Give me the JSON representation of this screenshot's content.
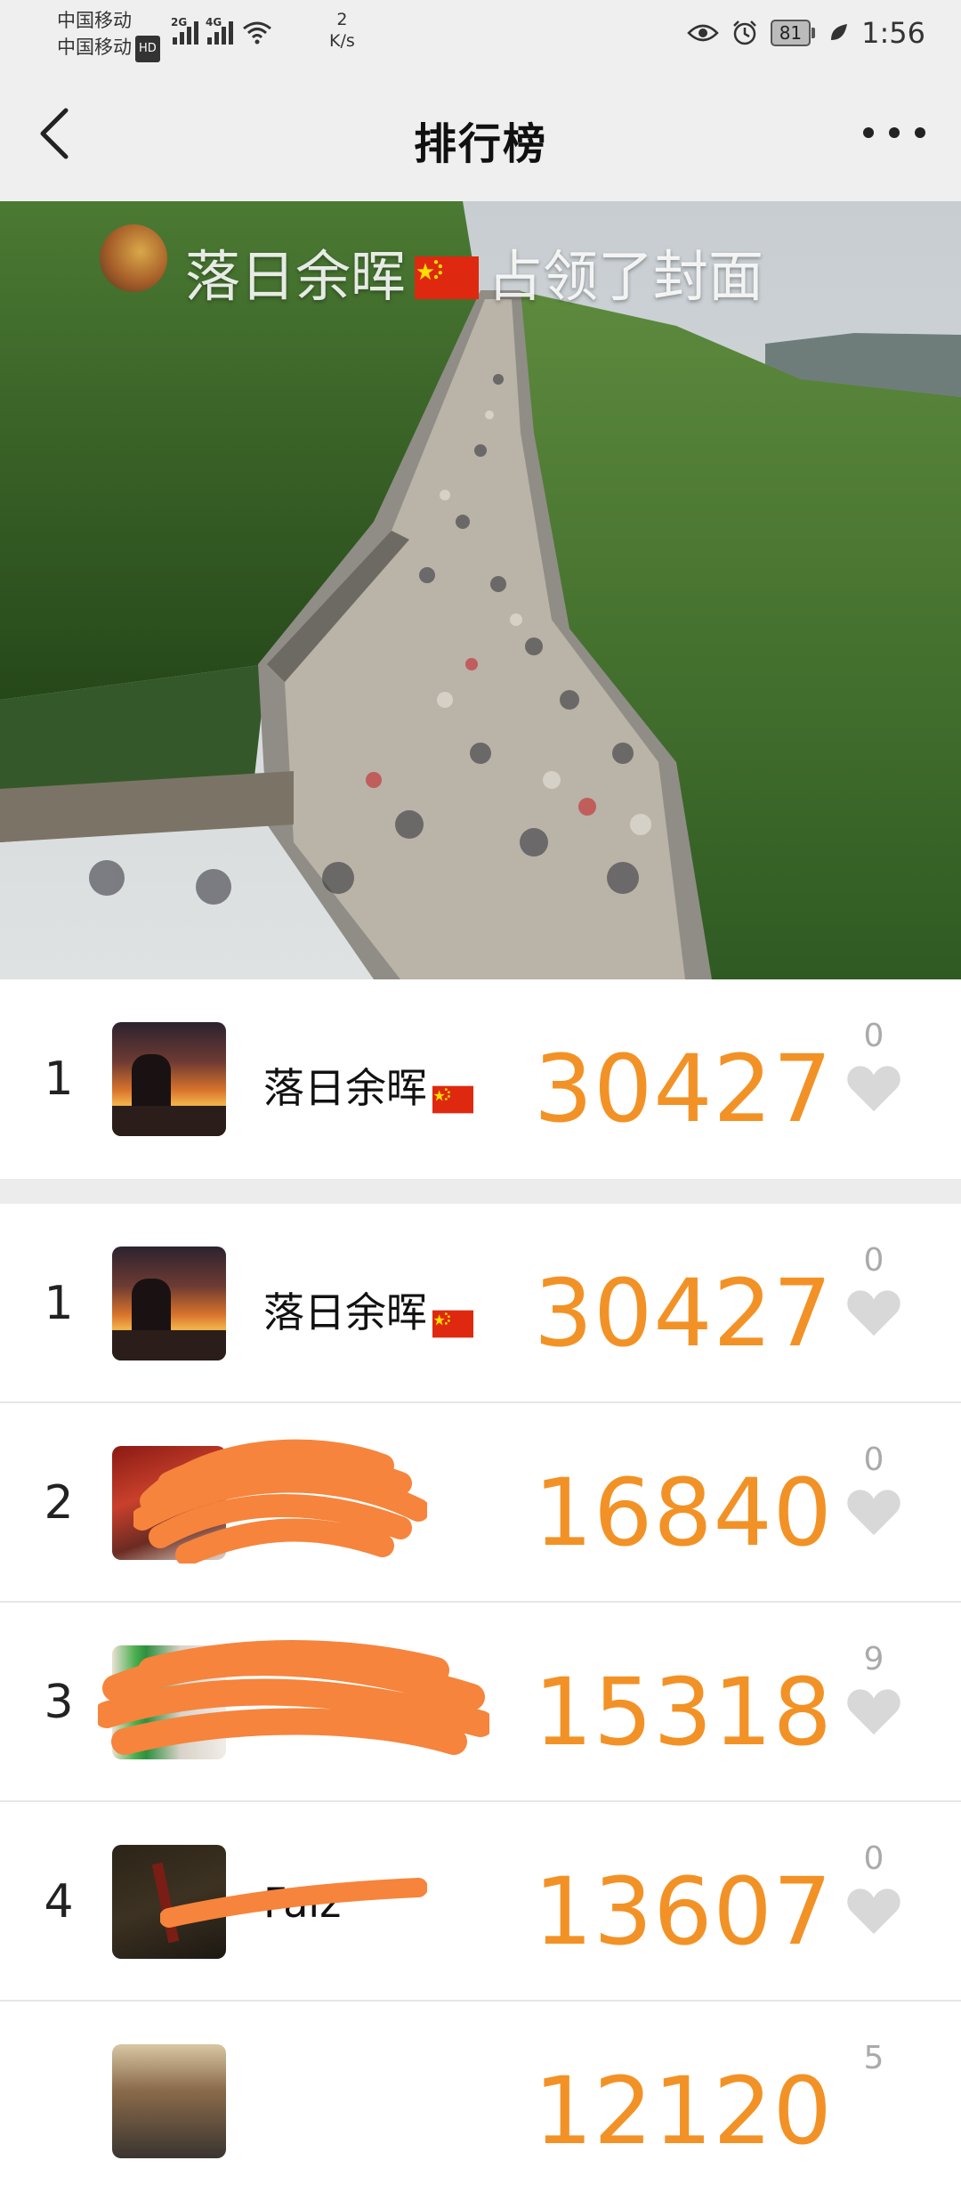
{
  "status_bar": {
    "carrier_1": "中国移动",
    "carrier_2": "中国移动",
    "hd": "HD",
    "net_1": "2G",
    "net_2": "4G",
    "speed_value": "2",
    "speed_unit": "K/s",
    "battery": "81",
    "time": "1:56"
  },
  "nav": {
    "title": "排行榜"
  },
  "cover": {
    "user_name": "落日余晖",
    "suffix": "占领了封面"
  },
  "featured": {
    "rank": "1",
    "name": "落日余晖",
    "score": "30427",
    "likes": "0"
  },
  "ranking": [
    {
      "rank": "1",
      "name": "落日余晖",
      "score": "30427",
      "likes": "0"
    },
    {
      "rank": "2",
      "name": "",
      "score": "16840",
      "likes": "0"
    },
    {
      "rank": "3",
      "name": "",
      "score": "15318",
      "likes": "9"
    },
    {
      "rank": "4",
      "name": "Faiz",
      "score": "13607",
      "likes": "0"
    },
    {
      "rank": "",
      "name": "",
      "score": "12120",
      "likes": "5"
    }
  ],
  "colors": {
    "score": "#f29226",
    "like_icon": "#d8d8d8",
    "redaction": "#f6843c"
  }
}
